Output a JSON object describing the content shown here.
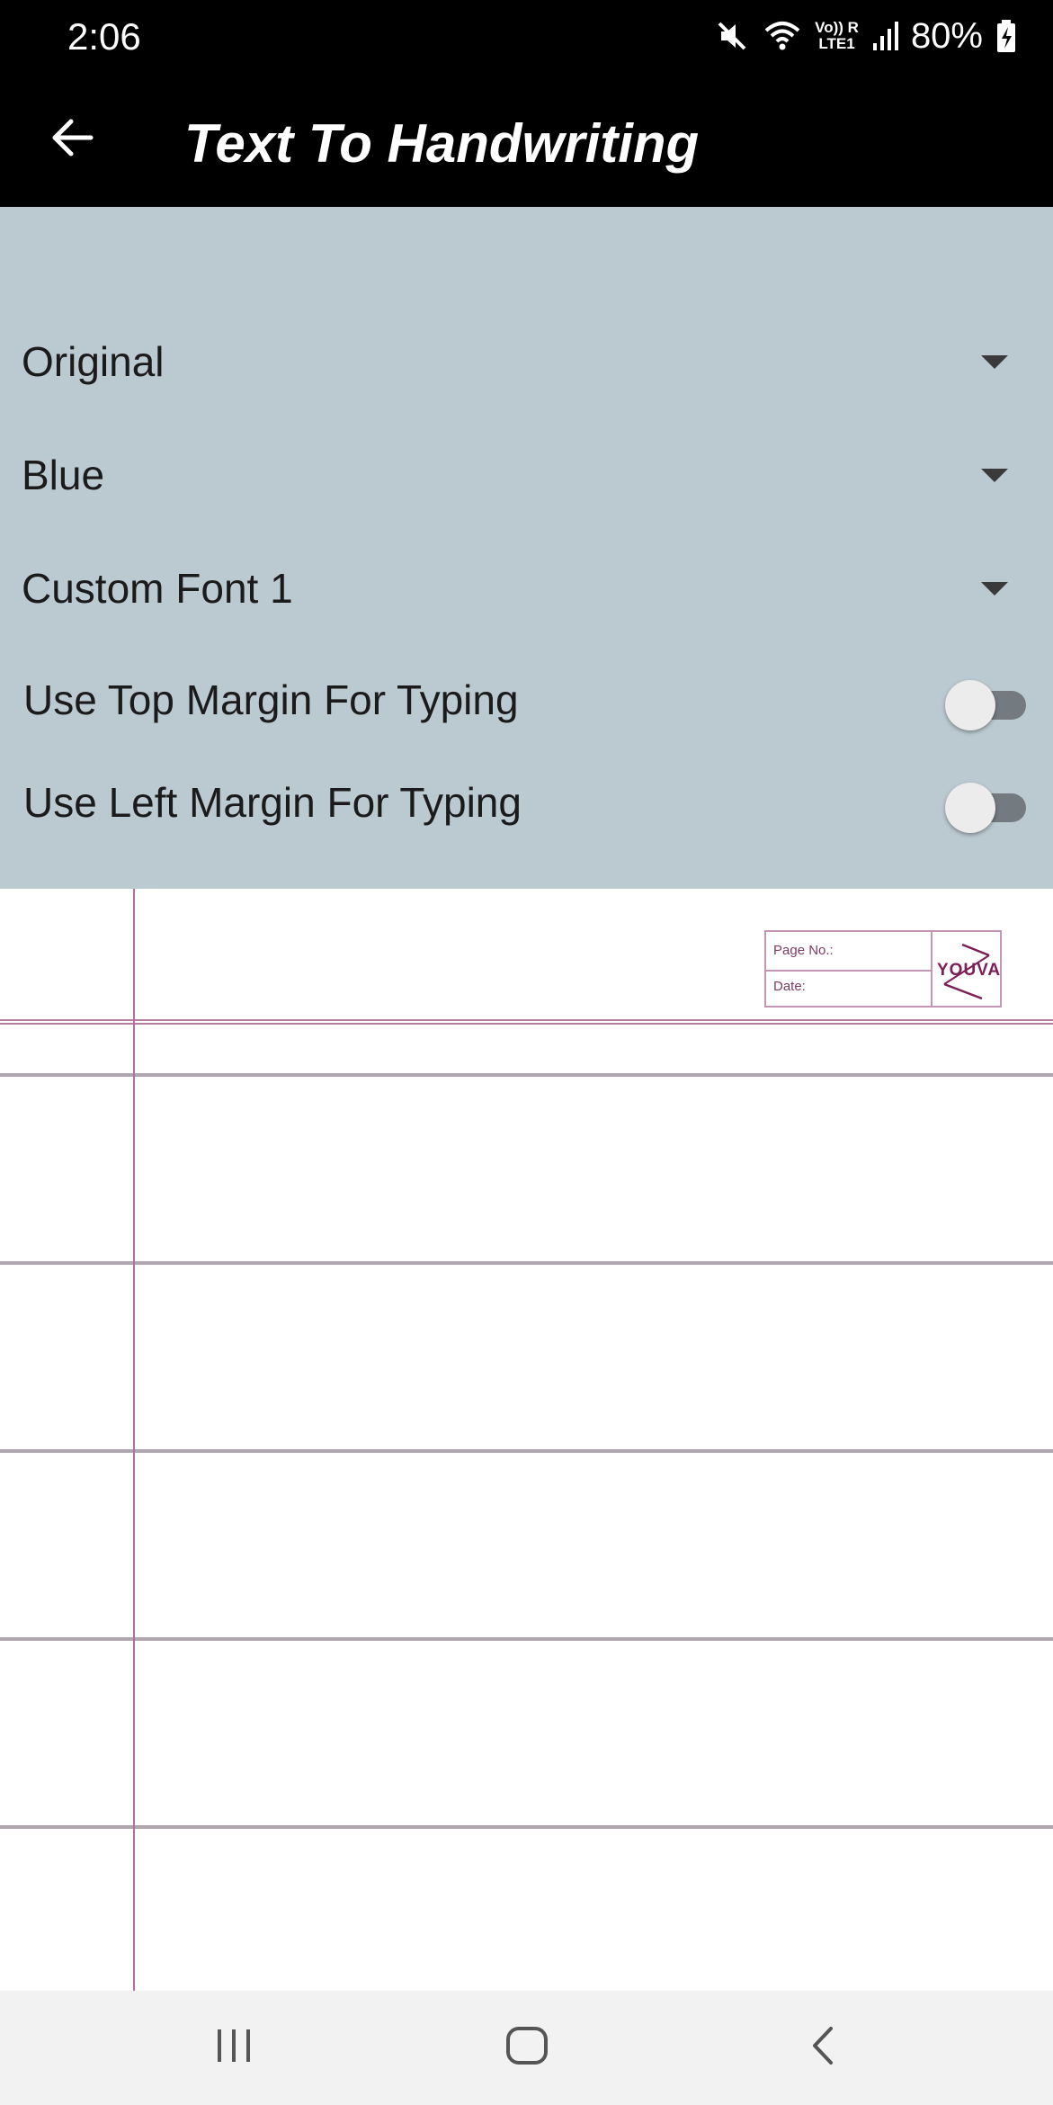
{
  "status_bar": {
    "time": "2:06",
    "battery": "80%",
    "network_top": "Vo)) R",
    "network_bottom": "LTE1",
    "icons": [
      "mute-icon",
      "wifi-icon",
      "signal-icon",
      "battery-charging-icon"
    ]
  },
  "app_bar": {
    "title": "Text To Handwriting",
    "back_icon": "arrow-left-icon"
  },
  "settings": {
    "paper_dropdown": {
      "selected": "Original"
    },
    "color_dropdown": {
      "selected": "Blue"
    },
    "font_dropdown": {
      "selected": "Custom Font 1"
    },
    "top_margin_toggle": {
      "label": "Use Top Margin For Typing",
      "on": false
    },
    "left_margin_toggle": {
      "label": "Use Left Margin For Typing",
      "on": false
    }
  },
  "notebook": {
    "page_no_label": "Page No.:",
    "date_label": "Date:",
    "brand": "YOUVA"
  },
  "nav_bar": {
    "buttons": [
      "recent-apps",
      "home",
      "back"
    ]
  },
  "colors": {
    "status_bar_bg": "#000000",
    "panel_bg": "#bbc9d0",
    "margin_line": "#b06fa0",
    "rule_line": "#b0a6b0",
    "nav_bg": "#f2f2f2"
  }
}
